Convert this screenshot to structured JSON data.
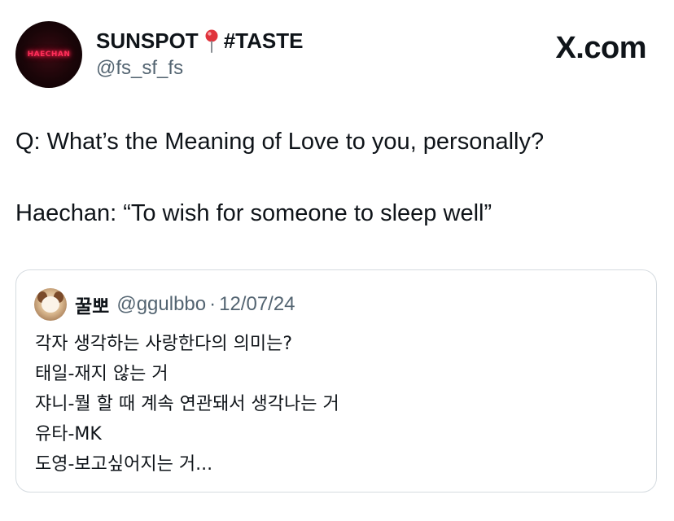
{
  "author": {
    "avatar_text": "HAECHAN",
    "display_name_part1": "SUNSPOT",
    "pin_icon": "round-pushpin-icon",
    "display_name_part2": "#TASTE",
    "handle": "@fs_sf_fs"
  },
  "brand": {
    "label": "X.com"
  },
  "tweet": {
    "lines": [
      "Q: What’s the Meaning of Love to you, personally?",
      "Haechan: “To wish for someone to sleep well”"
    ]
  },
  "quote": {
    "name": "꿀뽀",
    "handle": "@ggulbbo",
    "separator": "·",
    "date": "12/07/24",
    "lines": [
      "각자 생각하는 사랑한다의 의미는?",
      "태일-재지 않는 거",
      "쟈니-뭘 할 때 계속 연관돼서 생각나는 거",
      "유타-MK",
      "도영-보고싶어지는 거..."
    ]
  },
  "colors": {
    "primary_text": "#0f1419",
    "secondary_text": "#536471",
    "card_border": "#d5dbe0",
    "avatar_glow": "#ff2f5a",
    "pin_red": "#e0333c"
  }
}
